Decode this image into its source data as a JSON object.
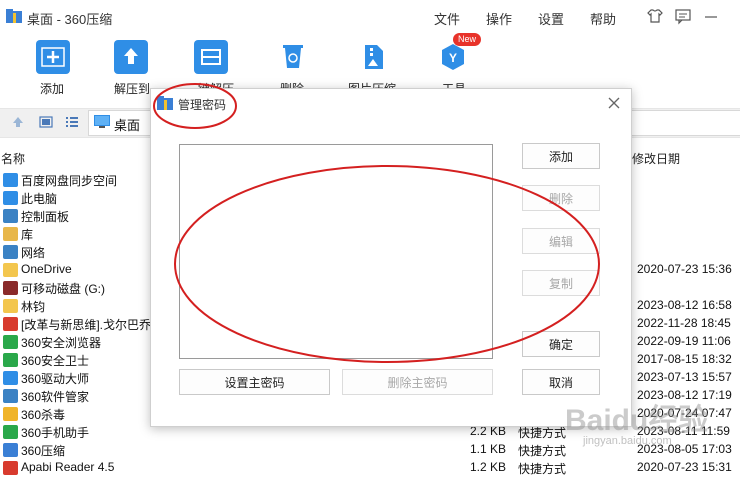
{
  "window": {
    "title": "桌面 - 360压缩",
    "menu": [
      "文件",
      "操作",
      "设置",
      "帮助"
    ]
  },
  "toolbar": {
    "items": [
      {
        "label": "添加",
        "icon": "add-icon"
      },
      {
        "label": "解压到",
        "icon": "extract-icon"
      },
      {
        "label": "一键解压",
        "icon": "one-click-extract-icon"
      },
      {
        "label": "删除",
        "icon": "recycle-icon"
      },
      {
        "label": "图片压缩",
        "icon": "image-compress-icon"
      },
      {
        "label": "工具",
        "icon": "tools-icon",
        "badge": "New"
      }
    ]
  },
  "address": {
    "location": "桌面"
  },
  "columns": {
    "name": "名称",
    "modified": "修改日期"
  },
  "files": [
    {
      "name": "百度网盘同步空间",
      "size": "",
      "type": "",
      "date": "",
      "icon": "cloud-icon"
    },
    {
      "name": "此电脑",
      "size": "",
      "type": "",
      "date": "",
      "icon": "computer-icon"
    },
    {
      "name": "控制面板",
      "size": "",
      "type": "",
      "date": "",
      "icon": "control-panel-icon"
    },
    {
      "name": "库",
      "size": "",
      "type": "",
      "date": "",
      "icon": "library-icon"
    },
    {
      "name": "网络",
      "size": "",
      "type": "",
      "date": "",
      "icon": "network-icon"
    },
    {
      "name": "OneDrive",
      "size": "",
      "type": "",
      "date": "2020-07-23 15:36",
      "icon": "folder-icon"
    },
    {
      "name": "可移动磁盘 (G:)",
      "size": "",
      "type": "",
      "date": "",
      "icon": "removable-disk-icon"
    },
    {
      "name": "林钧",
      "size": "",
      "type": "",
      "date": "2023-08-12 16:58",
      "icon": "folder-icon"
    },
    {
      "name": "[改革与新思维].戈尔巴乔",
      "size": "",
      "type": "",
      "date": "2022-11-28 18:45",
      "icon": "pdf-icon"
    },
    {
      "name": "360安全浏览器",
      "size": "",
      "type": "",
      "date": "2022-09-19 11:06",
      "icon": "browser-360-icon"
    },
    {
      "name": "360安全卫士",
      "size": "",
      "type": "",
      "date": "2017-08-15 18:32",
      "icon": "security-360-icon"
    },
    {
      "name": "360驱动大师",
      "size": "",
      "type": "",
      "date": "2023-07-13 15:57",
      "icon": "driver-360-icon"
    },
    {
      "name": "360软件管家",
      "size": "",
      "type": "",
      "date": "2023-08-12 17:19",
      "icon": "software-360-icon"
    },
    {
      "name": "360杀毒",
      "size": "",
      "type": "",
      "date": "2020-07-24 07:47",
      "icon": "antivirus-360-icon"
    },
    {
      "name": "360手机助手",
      "size": "2.2 KB",
      "type": "快捷方式",
      "date": "2023-08-11 11:59",
      "icon": "phone-360-icon"
    },
    {
      "name": "360压缩",
      "size": "1.1 KB",
      "type": "快捷方式",
      "date": "2023-08-05 17:03",
      "icon": "zip-360-icon"
    },
    {
      "name": "Apabi Reader 4.5",
      "size": "1.2 KB",
      "type": "快捷方式",
      "date": "2020-07-23 15:31",
      "icon": "apabi-icon"
    }
  ],
  "dialog": {
    "title": "管理密码",
    "buttons": {
      "add": "添加",
      "delete": "删除",
      "edit": "编辑",
      "copy": "复制",
      "ok": "确定",
      "cancel": "取消",
      "set_master": "设置主密码",
      "delete_master": "删除主密码"
    }
  },
  "watermark": {
    "brand": "Baidu经验",
    "url": "jingyan.baidu.com"
  },
  "colors": {
    "accent": "#2f8ee6",
    "annotation": "#d42020",
    "disabled": "#a8a8a8"
  }
}
